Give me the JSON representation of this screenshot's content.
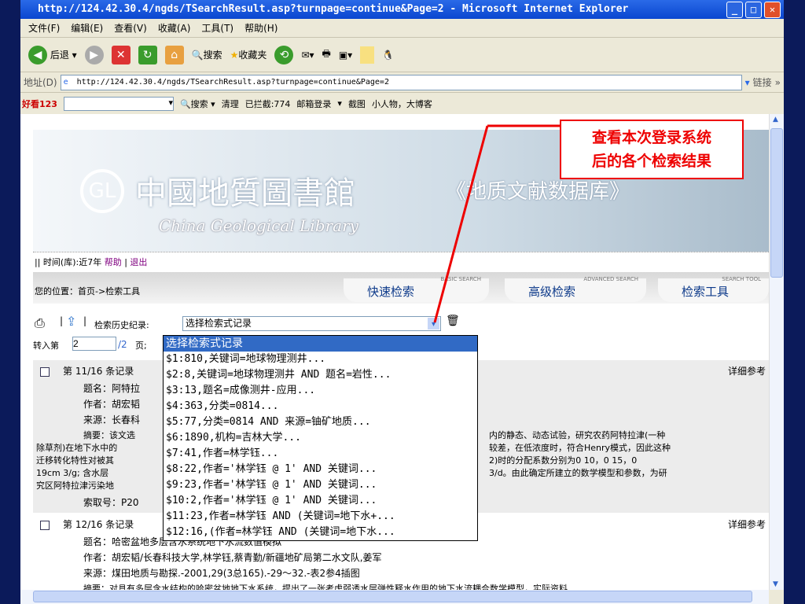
{
  "window": {
    "title": "http://124.42.30.4/ngds/TSearchResult.asp?turnpage=continue&Page=2 - Microsoft Internet Explorer"
  },
  "menu": [
    "文件(F)",
    "编辑(E)",
    "查看(V)",
    "收藏(A)",
    "工具(T)",
    "帮助(H)"
  ],
  "toolbar": {
    "back": "后退",
    "search": "搜索",
    "favorites": "收藏夹"
  },
  "address": {
    "label": "地址(D)",
    "url": "http://124.42.30.4/ngds/TSearchResult.asp?turnpage=continue&Page=2",
    "links": "链接"
  },
  "haokan": {
    "logo": "好看123",
    "search": "搜索",
    "clean": "清理",
    "blocked": "已拦截:774",
    "mail": "邮箱登录",
    "capture": "截图",
    "blog": "小人物，大博客"
  },
  "banner": {
    "title_cn": "中國地質圖書館",
    "title_en": "China Geological Library",
    "db": "《地质文献数据库》"
  },
  "nav": {
    "time": "|| 时间(库):近7年",
    "help": "帮助",
    "sep": "|",
    "logout": "退出"
  },
  "breadcrumb": "您的位置：首页->检索工具",
  "tabs": [
    {
      "en": "BASIC SEARCH",
      "cn": "快速检索"
    },
    {
      "en": "ADVANCED SEARCH",
      "cn": "高级检索"
    },
    {
      "en": "SEARCH TOOL",
      "cn": "检索工具"
    }
  ],
  "history": {
    "label": "检索历史纪录:",
    "selected": "选择检索式记录"
  },
  "pager": {
    "label": "转入第",
    "value": "2",
    "total": "/2",
    "suffix": "页;"
  },
  "dropdown": [
    "选择检索式记录",
    "$1:810,关键词=地球物理测井...",
    "$2:8,关键词=地球物理测井 AND 题名=岩性...",
    "$3:13,题名=成像测井-应用...",
    "$4:363,分类=0814...",
    "$5:77,分类=0814 AND 来源=铀矿地质...",
    "$6:1890,机构=吉林大学...",
    "$7:41,作者=林学钰...",
    "$8:22,作者='林学钰 @ 1' AND 关键词...",
    "$9:23,作者='林学钰 @ 1' AND 关键词...",
    "$10:2,作者='林学钰 @ 1' AND 关键词...",
    "$11:23,作者=林学钰 AND (关键词=地下水+...",
    "$12:16,(作者=林学钰 AND (关键词=地下水..."
  ],
  "records": [
    {
      "head": "第 11/16 条记录",
      "detail": "详细参考",
      "title": "题名：阿特拉",
      "author": "作者：胡宏韬",
      "source": "来源：长春科",
      "abs1a": "摘要：该文选",
      "abs1b": "内的静态、动态试验，研究农药阿特拉津(一种",
      "abs2a": "除草剂)在地下水中的",
      "abs2b": "较差，在低浓度时，符合Henry模式，因此这种",
      "abs3a": "迁移转化特性对被其",
      "abs3b": "2)时的分配系数分别为0  10，0  15，0",
      "abs4a": "19cm  3/g; 含水层",
      "abs4b": "3/d。由此确定所建立的数学模型和参数，为研",
      "abs5a": "究区阿特拉津污染地",
      "callno": "索取号：P20"
    },
    {
      "head": "第 12/16 条记录",
      "detail": "详细参考",
      "title": "题名：哈密盆地多层含水系统地下水流数值模拟",
      "author": "作者：胡宏韬/长春科技大学,林学钰,蔡青勤/新疆地矿局第二水文队,姜军",
      "source": "来源：煤田地质与勘探.-2001,29(3总165).-29～32.-表2参4插图",
      "abs": "摘要：对具有多层含水结构的哈密盆地地下水系统，提出了一张考虑弱透水层弹性释水作用的地下水流耦合数学模型，实际资料"
    }
  ],
  "callout": [
    "查看本次登录系统",
    "后的各个检索结果"
  ],
  "colors": {
    "callout": "#ee0000",
    "highlight": "#316ac5",
    "link": "#800080"
  }
}
